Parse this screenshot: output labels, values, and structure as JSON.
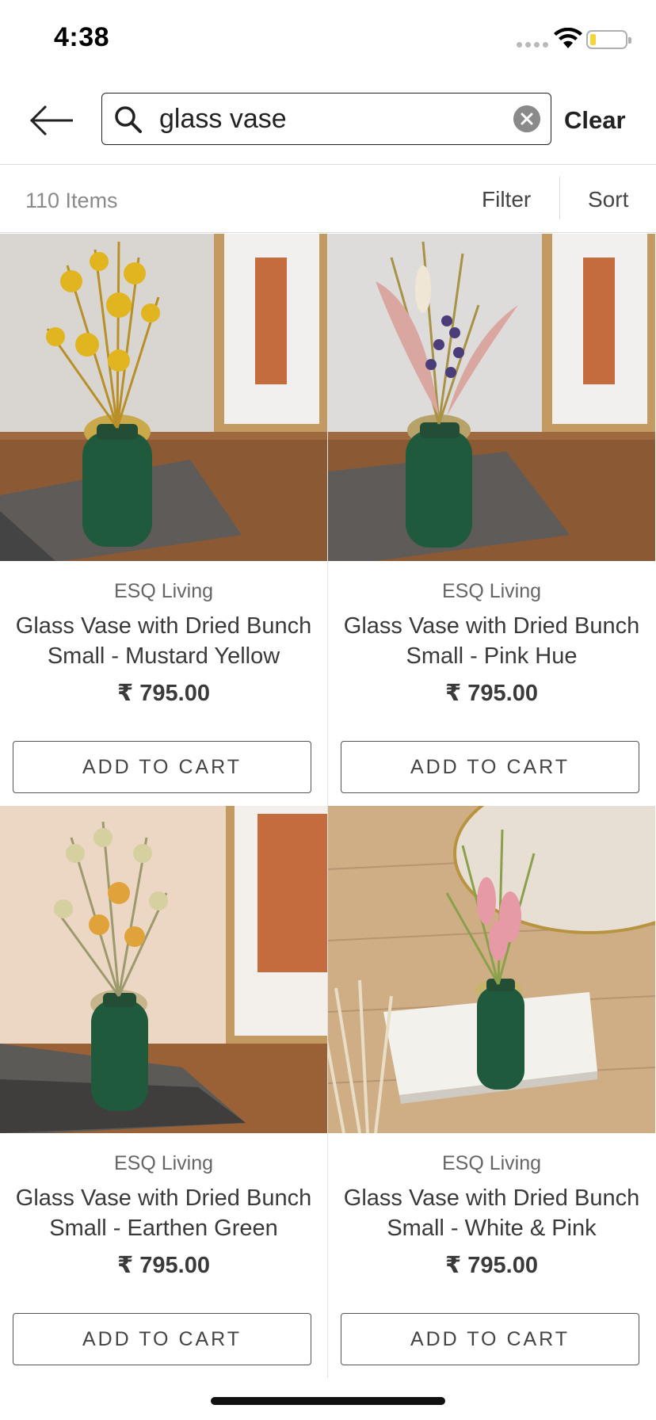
{
  "status_bar": {
    "time": "4:38"
  },
  "search": {
    "query": "glass vase",
    "clear_label": "Clear"
  },
  "results": {
    "count_label": "110 Items",
    "filter_label": "Filter",
    "sort_label": "Sort"
  },
  "products": [
    {
      "brand": "ESQ Living",
      "title": "Glass Vase with Dried Bunch Small - Mustard Yellow",
      "price": "₹ 795.00",
      "cta": "ADD TO CART"
    },
    {
      "brand": "ESQ Living",
      "title": "Glass Vase with Dried Bunch Small - Pink Hue",
      "price": "₹ 795.00",
      "cta": "ADD TO CART"
    },
    {
      "brand": "ESQ Living",
      "title": "Glass Vase with Dried Bunch Small - Earthen Green",
      "price": "₹ 795.00",
      "cta": "ADD TO CART"
    },
    {
      "brand": "ESQ Living",
      "title": "Glass Vase with Dried Bunch Small - White & Pink",
      "price": "₹ 795.00",
      "cta": "ADD TO CART"
    }
  ],
  "colors": {
    "vase_green": "#1f5a3c",
    "accent_text": "#3a3a3a",
    "muted_text": "#8a8a8a"
  }
}
